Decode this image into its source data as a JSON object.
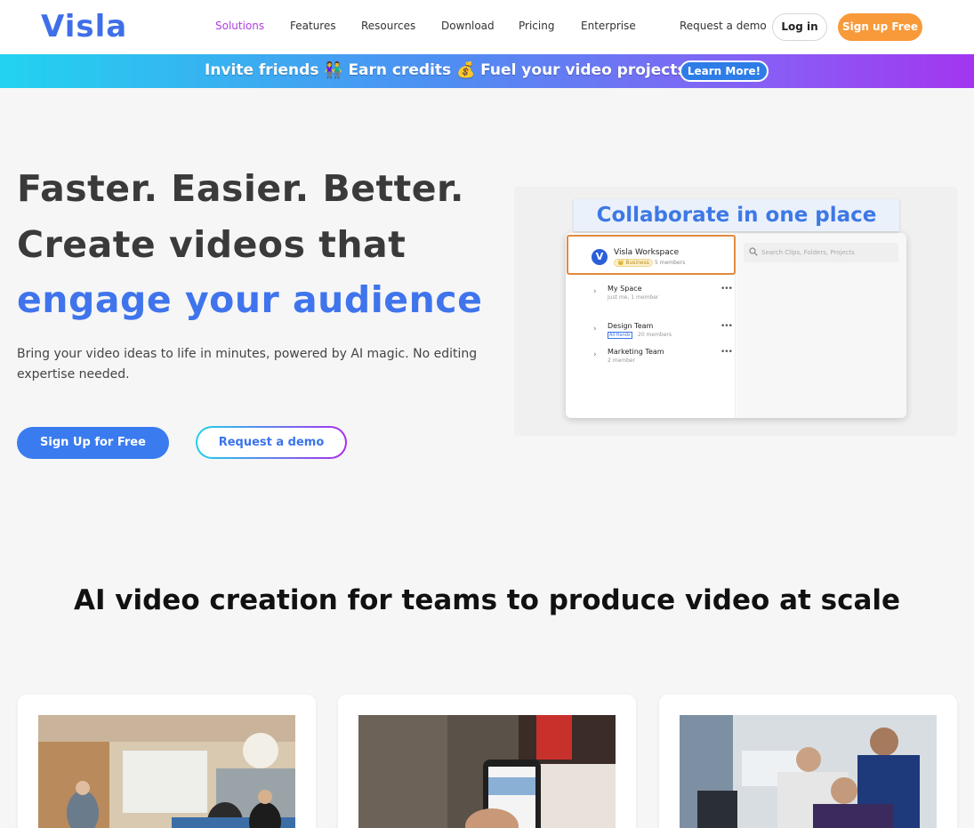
{
  "nav": {
    "logo": "Visla",
    "links": [
      "Solutions",
      "Features",
      "Resources",
      "Download",
      "Pricing",
      "Enterprise"
    ],
    "request_demo": "Request a demo",
    "login": "Log in",
    "signup": "Sign up Free"
  },
  "banner": {
    "text": "Invite friends 👫 Earn credits 💰 Fuel your video projects 🎉",
    "button": "Learn More!"
  },
  "hero": {
    "line1": "Faster. Easier. Better.",
    "line2": "Create videos that",
    "line3": "engage your audience",
    "subtitle": "Bring your video ideas to life in minutes, powered by AI magic. No editing expertise needed.",
    "signup_button": "Sign Up for Free",
    "demo_button": "Request a demo"
  },
  "illustration": {
    "title": "Collaborate in one place",
    "workspace_name": "Visla Workspace",
    "workspace_badge": "👑 Business",
    "workspace_members": "5 members",
    "search_placeholder": "Search Clips, Folders, Projects",
    "rows": [
      {
        "name": "My Space",
        "sub": "Just me, 1 member"
      },
      {
        "name": "Design Team",
        "tag": "All Hands",
        "sub": "20 members"
      },
      {
        "name": "Marketing Team",
        "sub": "2 member"
      }
    ]
  },
  "section": {
    "title": "AI video creation for teams to produce video at scale"
  },
  "colors": {
    "brand_blue": "#3f74ec",
    "orange": "#f89a3a",
    "purple_active": "#b03ee0"
  }
}
